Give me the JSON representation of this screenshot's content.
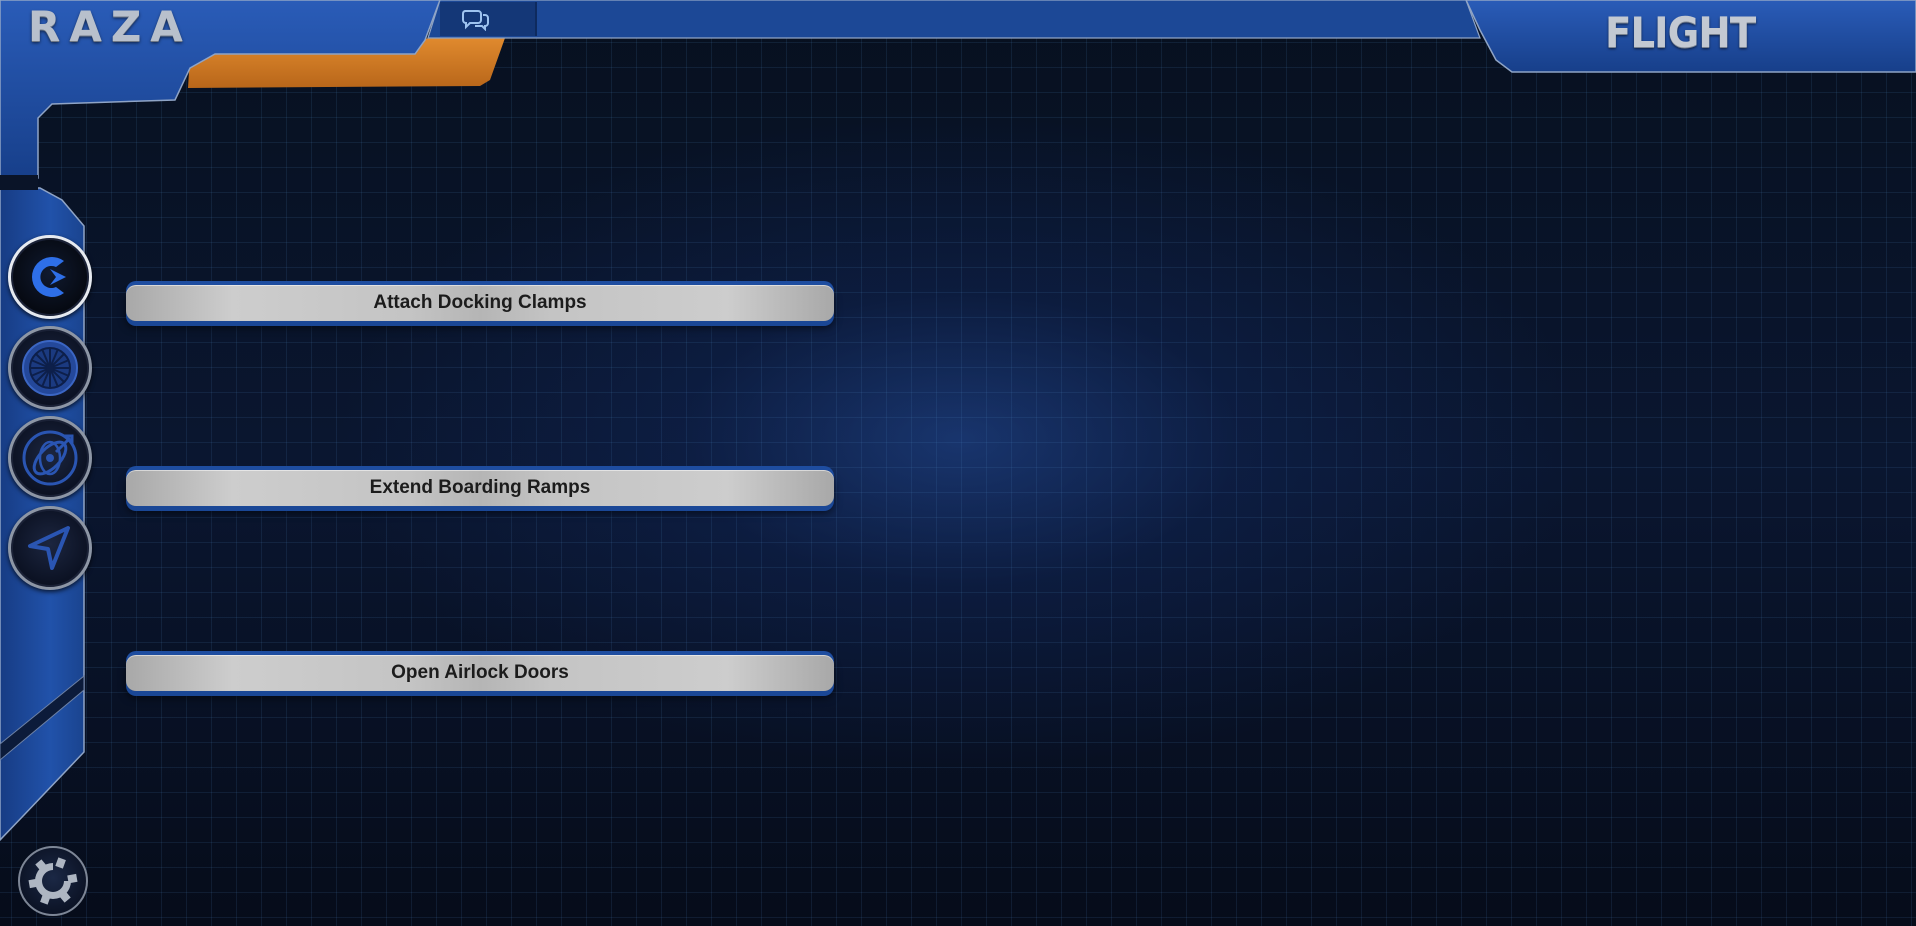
{
  "app": {
    "logo": "RAZA"
  },
  "header": {
    "section_title": "FLIGHT",
    "chat_icon": "chat-bubbles-icon"
  },
  "colors": {
    "accent_blue": "#1e4da0",
    "accent_orange": "#d07a24",
    "frame_blue": "#1d4a9a"
  },
  "sidebar": {
    "items": [
      {
        "icon": "docking-icon",
        "active": true
      },
      {
        "icon": "engine-turbine-icon",
        "active": false
      },
      {
        "icon": "orbit-target-icon",
        "active": false
      },
      {
        "icon": "navigation-arrow-icon",
        "active": false
      }
    ],
    "settings_icon": "gear-icon"
  },
  "actions": [
    {
      "label": "Attach Docking Clamps"
    },
    {
      "label": "Extend Boarding Ramps"
    },
    {
      "label": "Open Airlock Doors"
    }
  ]
}
